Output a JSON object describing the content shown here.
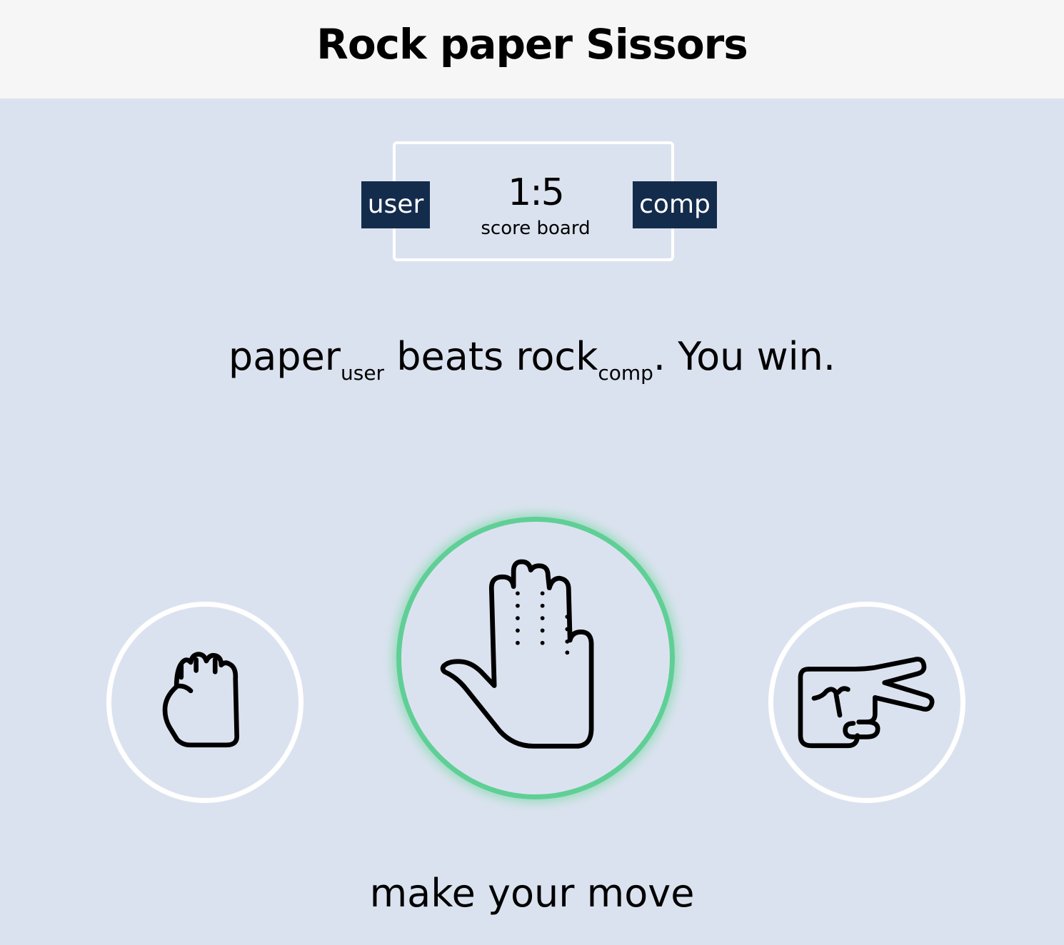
{
  "header": {
    "title": "Rock paper Sissors"
  },
  "scoreboard": {
    "user_label": "user",
    "comp_label": "comp",
    "score": "1:5",
    "label": "score board"
  },
  "result": {
    "user_choice": "paper",
    "user_tag": "user",
    "verb": "beats",
    "comp_choice": "rock",
    "comp_tag": "comp",
    "outcome": ". You win."
  },
  "choices": [
    {
      "id": "rock",
      "icon": "rock-fist-icon",
      "selected": false
    },
    {
      "id": "paper",
      "icon": "paper-hand-icon",
      "selected": true
    },
    {
      "id": "scissors",
      "icon": "scissors-fingers-icon",
      "selected": false
    }
  ],
  "colors": {
    "background": "#dbe2ef",
    "header": "#f7f6f7",
    "badge": "#142c4c",
    "win_highlight": "#5fcf96"
  },
  "prompt": "make your move"
}
